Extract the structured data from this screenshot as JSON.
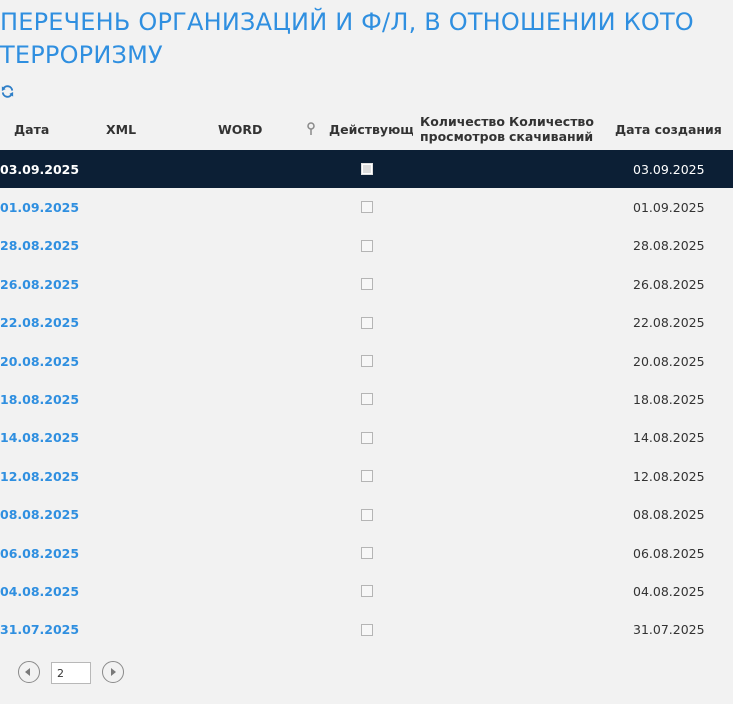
{
  "page": {
    "title_line1": "ПЕРЕЧЕНЬ ОРГАНИЗАЦИЙ И Ф/Л, В ОТНОШЕНИИ КОТО",
    "title_line2": "ТЕРРОРИЗМУ"
  },
  "toolbar": {
    "refresh_icon": "refresh-icon"
  },
  "table": {
    "headers": {
      "date": "Дата",
      "xml": "XML",
      "word": "WORD",
      "pin_icon": "pin-icon",
      "active": "Действующ",
      "views_line1": "Количество",
      "views_line2": "просмотров",
      "downloads_line1": "Количество",
      "downloads_line2": "скачиваний",
      "created": "Дата создания"
    },
    "rows": [
      {
        "date": "03.09.2025",
        "created": "03.09.2025",
        "selected": true
      },
      {
        "date": "01.09.2025",
        "created": "01.09.2025"
      },
      {
        "date": "28.08.2025",
        "created": "28.08.2025"
      },
      {
        "date": "26.08.2025",
        "created": "26.08.2025"
      },
      {
        "date": "22.08.2025",
        "created": "22.08.2025"
      },
      {
        "date": "20.08.2025",
        "created": "20.08.2025"
      },
      {
        "date": "18.08.2025",
        "created": "18.08.2025"
      },
      {
        "date": "14.08.2025",
        "created": "14.08.2025"
      },
      {
        "date": "12.08.2025",
        "created": "12.08.2025"
      },
      {
        "date": "08.08.2025",
        "created": "08.08.2025"
      },
      {
        "date": "06.08.2025",
        "created": "06.08.2025"
      },
      {
        "date": "04.08.2025",
        "created": "04.08.2025"
      },
      {
        "date": "31.07.2025",
        "created": "31.07.2025"
      }
    ]
  },
  "pager": {
    "current_page": "2",
    "prev_icon": "chevron-left-icon",
    "next_icon": "chevron-right-icon"
  },
  "colors": {
    "accent": "#2f8fe0",
    "selected_row": "#0c1f35",
    "background": "#f2f2f2"
  }
}
